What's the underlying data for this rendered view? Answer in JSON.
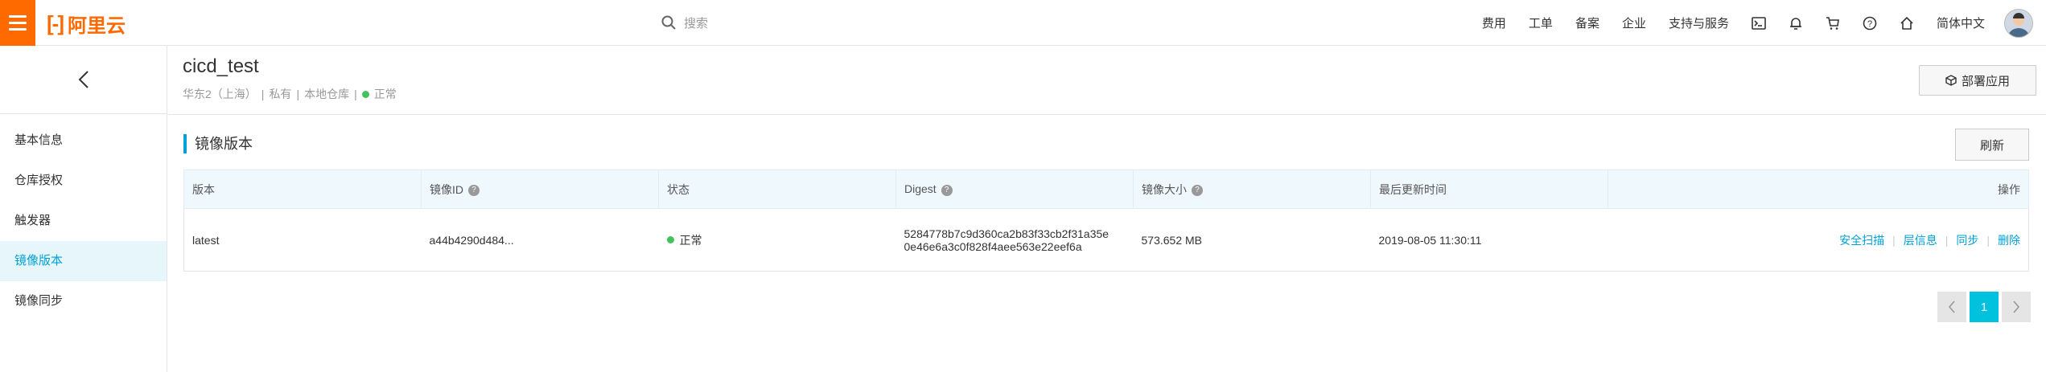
{
  "topbar": {
    "logo_text": "阿里云",
    "search_placeholder": "搜索",
    "nav": [
      "费用",
      "工单",
      "备案",
      "企业",
      "支持与服务"
    ],
    "language": "简体中文",
    "brand_color": "#ff6a00"
  },
  "sidebar": {
    "items": [
      {
        "label": "基本信息"
      },
      {
        "label": "仓库授权"
      },
      {
        "label": "触发器"
      },
      {
        "label": "镜像版本"
      },
      {
        "label": "镜像同步"
      }
    ],
    "active_index": 3
  },
  "header": {
    "repo_name": "cicd_test",
    "region": "华东2（上海）",
    "visibility": "私有",
    "source": "本地仓库",
    "status": "正常",
    "deploy_label": "部署应用"
  },
  "section": {
    "title": "镜像版本",
    "refresh_label": "刷新"
  },
  "table": {
    "headers": [
      "版本",
      "镜像ID",
      "状态",
      "Digest",
      "镜像大小",
      "最后更新时间",
      "操作"
    ],
    "rows": [
      {
        "version": "latest",
        "image_id": "a44b4290d484...",
        "status": "正常",
        "digest_line1": "5284778b7c9d360ca2b83f33cb2f31a35e",
        "digest_line2": "0e46e6a3c0f828f4aee563e22eef6a",
        "size": "573.652 MB",
        "updated": "2019-08-05 11:30:11",
        "ops": [
          "安全扫描",
          "层信息",
          "同步",
          "删除"
        ]
      }
    ]
  },
  "pagination": {
    "current": "1"
  }
}
